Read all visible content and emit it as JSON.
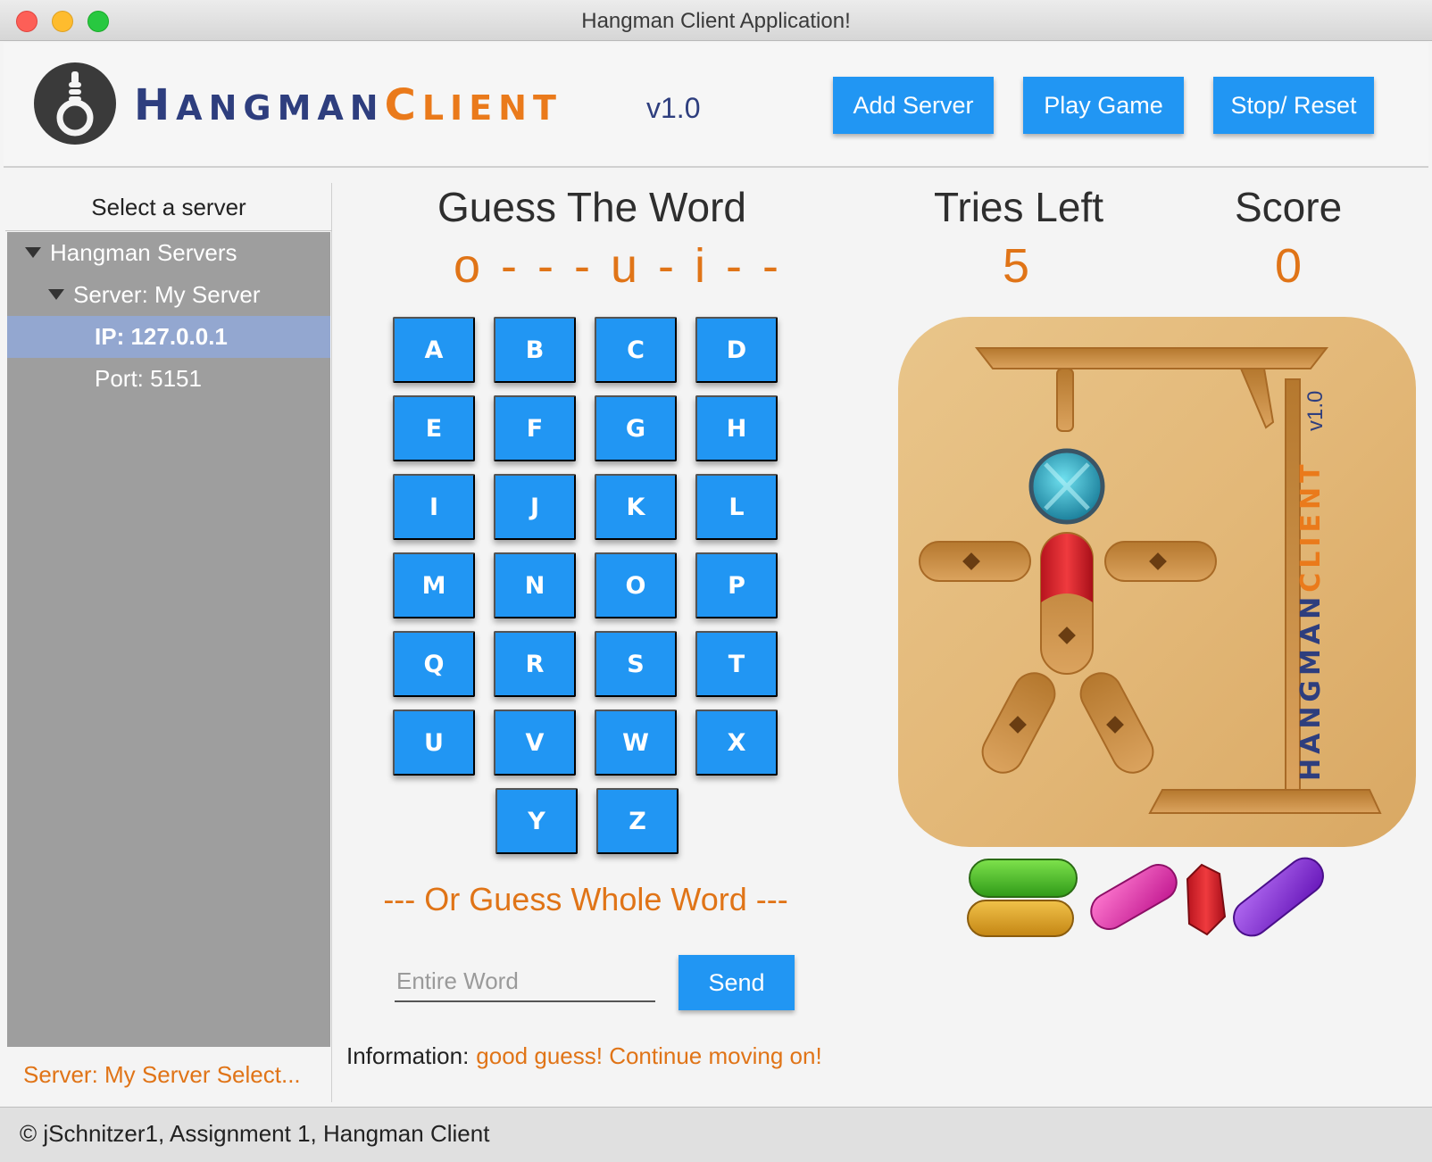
{
  "window": {
    "title": "Hangman Client Application!"
  },
  "header": {
    "brand_part1": "Hangman",
    "brand_part2": "Client",
    "version": "v1.0",
    "buttons": {
      "add_server": "Add Server",
      "play_game": "Play Game",
      "stop_reset": "Stop/ Reset"
    }
  },
  "sidebar": {
    "heading": "Select a server",
    "tree": [
      {
        "label": "Hangman Servers",
        "expanded": true,
        "level": 0
      },
      {
        "label": "Server: My Server",
        "expanded": true,
        "level": 1
      },
      {
        "label": "IP: 127.0.0.1",
        "selected": true,
        "level": 2
      },
      {
        "label": "Port: 5151",
        "level": 2
      }
    ],
    "status": "Server: My Server Select..."
  },
  "game": {
    "guess_label": "Guess The Word",
    "word_display": "o - - - u - i - -",
    "tries_label": "Tries Left",
    "tries_value": "5",
    "score_label": "Score",
    "score_value": "0",
    "letters": [
      "A",
      "B",
      "C",
      "D",
      "E",
      "F",
      "G",
      "H",
      "I",
      "J",
      "K",
      "L",
      "M",
      "N",
      "O",
      "P",
      "Q",
      "R",
      "S",
      "T",
      "U",
      "V",
      "W",
      "X",
      "Y",
      "Z"
    ],
    "or_guess_label": "--- Or Guess Whole Word ---",
    "word_input": {
      "value": "",
      "placeholder": "Entire Word"
    },
    "send_label": "Send",
    "info_label": "Information:",
    "info_message": "good guess! Continue moving on!",
    "board_brand_1": "Hangman",
    "board_brand_2": "Client",
    "board_version": "v1.0"
  },
  "footer": {
    "text": "© jSchnitzer1, Assignment 1, Hangman Client"
  },
  "colors": {
    "accent": "#2196f3",
    "orange": "#e07417",
    "navy": "#2e3e7e"
  }
}
